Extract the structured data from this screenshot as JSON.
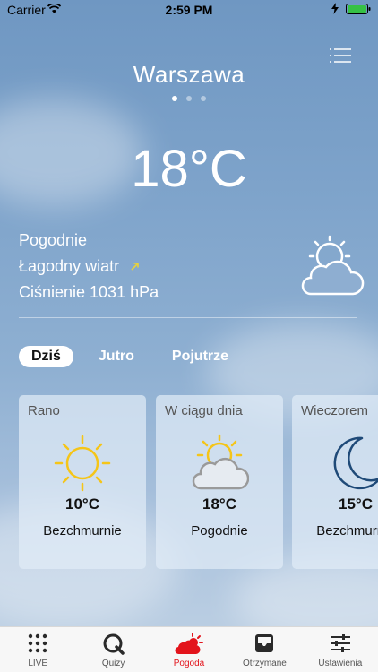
{
  "status_bar": {
    "carrier": "Carrier",
    "time": "2:59 PM"
  },
  "city": "Warszawa",
  "page_dots": 3,
  "temperature": "18°C",
  "conditions": {
    "summary": "Pogodnie",
    "wind": "Łagodny wiatr",
    "pressure": "Ciśnienie 1031 hPa"
  },
  "day_tabs": [
    "Dziś",
    "Jutro",
    "Pojutrze"
  ],
  "forecast": [
    {
      "title": "Rano",
      "temp": "10°C",
      "cond": "Bezchmurnie",
      "icon": "sun-icon"
    },
    {
      "title": "W ciągu dnia",
      "temp": "18°C",
      "cond": "Pogodnie",
      "icon": "partly-cloudy-icon"
    },
    {
      "title": "Wieczorem",
      "temp": "15°C",
      "cond": "Bezchmurnie",
      "icon": "moon-icon"
    }
  ],
  "tab_bar": [
    {
      "label": "LIVE",
      "icon": "live-grid-icon"
    },
    {
      "label": "Quizy",
      "icon": "quiz-icon"
    },
    {
      "label": "Pogoda",
      "icon": "weather-icon"
    },
    {
      "label": "Otrzymane",
      "icon": "inbox-icon"
    },
    {
      "label": "Ustawienia",
      "icon": "sliders-icon"
    }
  ],
  "colors": {
    "accent": "#e3141c",
    "sun": "#f5c518",
    "moon": "#1f4a78"
  }
}
